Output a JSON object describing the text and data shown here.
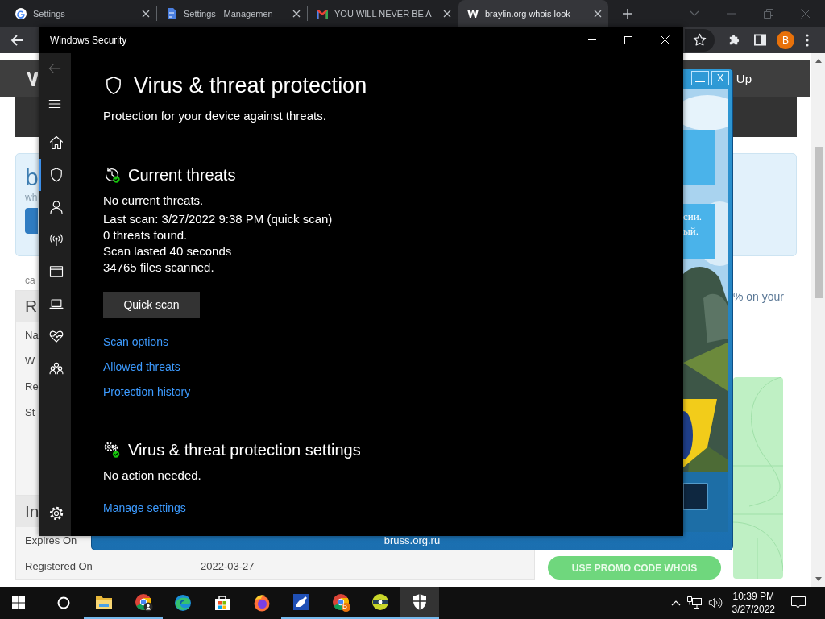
{
  "browser": {
    "tabs": [
      {
        "title": "Settings",
        "selected": false
      },
      {
        "title": "Settings - Managemen",
        "selected": false
      },
      {
        "title": "YOU WILL NEVER BE A",
        "selected": false
      },
      {
        "title": "braylin.org whois look",
        "selected": true
      }
    ],
    "profile_initial": "B",
    "page": {
      "header_right": "Up",
      "hero": {
        "heading": "b",
        "subheading": "wh"
      },
      "breadcrumb": "ca",
      "panels": [
        {
          "heading": "R",
          "rows": [
            {
              "label": "Na"
            },
            {
              "label": "W"
            },
            {
              "label": "Re"
            },
            {
              "label": "St"
            }
          ]
        },
        {
          "heading": "In",
          "rows": [
            {
              "label": "Expires On"
            },
            {
              "label": "Registered On",
              "value": "2022-03-27"
            }
          ]
        }
      ],
      "promo_text": "% on your",
      "promo_button": "USE PROMO CODE WHOIS"
    }
  },
  "popup": {
    "close": "X",
    "lines": [
      "сии.",
      "ый."
    ],
    "footer": "bruss.org.ru"
  },
  "security": {
    "title": "Windows Security",
    "back_disabled": true,
    "nav": [
      {
        "kind": "main",
        "selected": false
      },
      {
        "kind": "main",
        "selected": true
      },
      {
        "kind": "main",
        "selected": false
      },
      {
        "kind": "main",
        "selected": false
      },
      {
        "kind": "main",
        "selected": false
      },
      {
        "kind": "main",
        "selected": false
      },
      {
        "kind": "main",
        "selected": false
      },
      {
        "kind": "main",
        "selected": false
      },
      {
        "kind": "footer",
        "selected": false
      }
    ],
    "heading": "Virus & threat protection",
    "subtitle": "Protection for your device against threats.",
    "sections": [
      {
        "heading": "Current threats",
        "lines": [
          "No current threats.",
          "Last scan: 3/27/2022 9:38 PM (quick scan)",
          "0 threats found.",
          "Scan lasted 40 seconds",
          "34765 files scanned."
        ],
        "button": "Quick scan",
        "links": [
          "Scan options",
          "Allowed threats",
          "Protection history"
        ]
      },
      {
        "heading": "Virus & threat protection settings",
        "lines": [
          "No action needed."
        ],
        "links": [
          "Manage settings"
        ]
      }
    ]
  },
  "taskbar": {
    "apps": [
      {
        "running": true,
        "active": false
      },
      {
        "running": true,
        "active": false
      },
      {
        "running": false,
        "active": false
      },
      {
        "running": false,
        "active": false
      },
      {
        "running": false,
        "active": false
      },
      {
        "running": true,
        "active": false
      },
      {
        "badge": "B",
        "running": true,
        "active": false
      },
      {
        "running": true,
        "active": false
      },
      {
        "running": true,
        "active": true
      }
    ],
    "time": "10:39 PM",
    "date": "3/27/2022"
  }
}
